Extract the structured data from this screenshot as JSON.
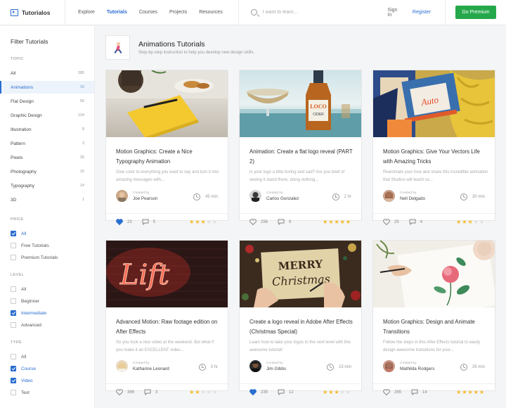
{
  "header": {
    "logo_text": "Tutorialos",
    "nav": [
      "Explore",
      "Tutorials",
      "Courses",
      "Projects",
      "Resources"
    ],
    "active_nav": "Tutorials",
    "search_placeholder": "I want to learn...",
    "signin_label": "Sign In",
    "register_label": "Register",
    "premium_label": "Go Premium"
  },
  "sidebar": {
    "title": "Filter Tutorials",
    "topic_label": "TOPIC",
    "topics": [
      {
        "label": "All",
        "count": "285"
      },
      {
        "label": "Animations",
        "count": "39"
      },
      {
        "label": "Flat Design",
        "count": "56"
      },
      {
        "label": "Graphic Design",
        "count": "124"
      },
      {
        "label": "Illustration",
        "count": "8"
      },
      {
        "label": "Pattern",
        "count": "3"
      },
      {
        "label": "Pixels",
        "count": "25"
      },
      {
        "label": "Photography",
        "count": "15"
      },
      {
        "label": "Typography",
        "count": "14"
      },
      {
        "label": "3D",
        "count": "1"
      }
    ],
    "price_label": "PRICE",
    "price": [
      {
        "label": "All",
        "checked": true
      },
      {
        "label": "Free Tutorials",
        "checked": false
      },
      {
        "label": "Premium Tutorials",
        "checked": false
      }
    ],
    "level_label": "LEVEL",
    "level": [
      {
        "label": "All",
        "checked": false
      },
      {
        "label": "Beginner",
        "checked": false
      },
      {
        "label": "Intermediate",
        "checked": true
      },
      {
        "label": "Advanced",
        "checked": false
      }
    ],
    "type_label": "TYPE",
    "type": [
      {
        "label": "All",
        "checked": false
      },
      {
        "label": "Course",
        "checked": true
      },
      {
        "label": "Video",
        "checked": true
      },
      {
        "label": "Text",
        "checked": false
      }
    ]
  },
  "main": {
    "title": "Animations Tutorials",
    "subtitle": "Step-by-step instruction to help you develop new design skills."
  },
  "cards": [
    {
      "title": "Motion Graphics: Create a Nice Typography Animation",
      "desc": "Give color to everything you want to say and turn it into amazing messages with...",
      "created_by": "Created by",
      "author": "Joe Pearson",
      "duration": "45 min",
      "likes": "23",
      "liked": true,
      "comments": "5",
      "rating": 3
    },
    {
      "title": "Animation: Create a flat logo reveal (PART 2)",
      "desc": "Is your logo a little boring and sad? Are you tired of seeing it stand there, doing nothing...",
      "created_by": "Created by",
      "author": "Carlos Gonzalez",
      "duration": "2 hr",
      "likes": "256",
      "liked": false,
      "comments": "9",
      "rating": 5
    },
    {
      "title": "Motion Graphics: Give Your Vectors Life with Amazing Tricks",
      "desc": "Reanimate your love and share this incredible animation that Studios will teach us...",
      "created_by": "Created by",
      "author": "Nell Delgado",
      "duration": "30 min",
      "likes": "25",
      "liked": false,
      "comments": "4",
      "rating": 3
    },
    {
      "title": "Advanced Motion: Raw footage edition on After Effects",
      "desc": "So you took a nice video at the weekend. But what if you make it an EXCELLENT video...",
      "created_by": "Created by",
      "author": "Katharine Leonard",
      "duration": "3 hr",
      "likes": "366",
      "liked": false,
      "comments": "3",
      "rating": 2
    },
    {
      "title": "Create a logo reveal in Adobe After Effects (Christmas Special)",
      "desc": "Learn how to take your logos to the next level with this awesome tutorial!",
      "created_by": "Created by",
      "author": "Jim Gibbs",
      "duration": "15 min",
      "likes": "235",
      "liked": true,
      "comments": "12",
      "rating": 3
    },
    {
      "title": "Motion Graphics: Design and Animate Transitions",
      "desc": "Follow the steps in this After Effects tutorial to easily design awesome transitions for your...",
      "created_by": "Created by",
      "author": "Mathilda Rodgers",
      "duration": "35 min",
      "likes": "265",
      "liked": false,
      "comments": "14",
      "rating": 5
    }
  ],
  "image_text": {
    "lift": "Lift",
    "merry": "MERRY",
    "christmas": "Christmas",
    "cider": "CIDER",
    "loco": "LOCO",
    "auto": "Auto"
  },
  "colors": {
    "accent": "#2a6ecf",
    "premium": "#25a84a",
    "star": "#f5b923"
  }
}
